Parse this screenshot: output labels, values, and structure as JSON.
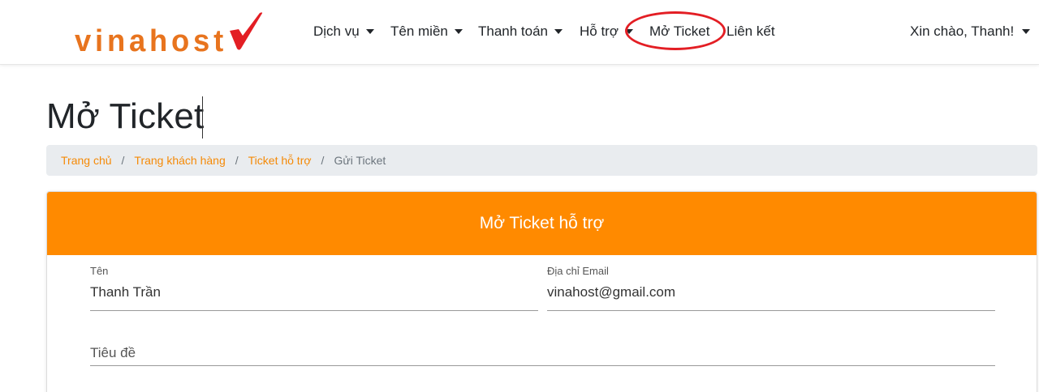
{
  "brand": {
    "logo_text": "vinahost",
    "logo_color": "#e8741e",
    "check_color": "#e31e24"
  },
  "nav": {
    "items": [
      {
        "label": "Dịch vụ",
        "has_dropdown": true
      },
      {
        "label": "Tên miền",
        "has_dropdown": true
      },
      {
        "label": "Thanh toán",
        "has_dropdown": true
      },
      {
        "label": "Hỗ trợ",
        "has_dropdown": true
      },
      {
        "label": "Mở Ticket",
        "has_dropdown": false,
        "highlighted": true
      },
      {
        "label": "Liên kết",
        "has_dropdown": false
      }
    ],
    "user_greeting": "Xin chào, Thanh!"
  },
  "page": {
    "title": "Mở Ticket"
  },
  "breadcrumb": {
    "items": [
      "Trang chủ",
      "Trang khách hàng",
      "Ticket hỗ trợ"
    ],
    "separator": "/",
    "active": "Gửi Ticket"
  },
  "form": {
    "header": "Mở Ticket hỗ trợ",
    "name": {
      "label": "Tên",
      "value": "Thanh Trần"
    },
    "email": {
      "label": "Địa chỉ Email",
      "value": "vinahost@gmail.com"
    },
    "subject": {
      "placeholder": "Tiêu đề"
    }
  },
  "colors": {
    "accent": "#ff8a00",
    "link": "#f58a07",
    "highlight_ring": "#e31e24",
    "breadcrumb_bg": "#e9ecef"
  }
}
